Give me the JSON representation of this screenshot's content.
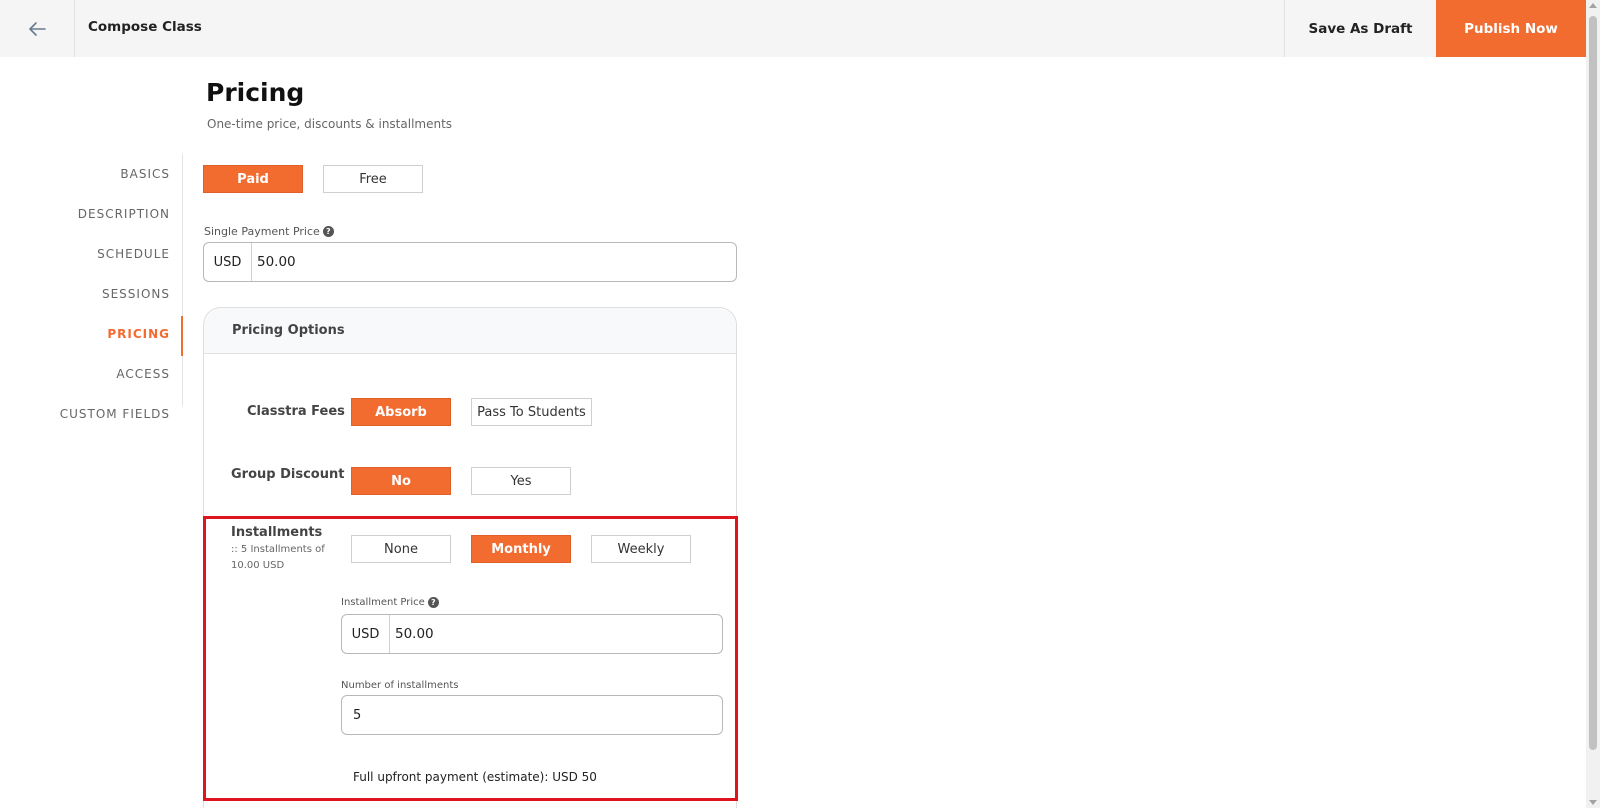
{
  "header": {
    "title": "Compose Class",
    "save_draft_label": "Save As Draft",
    "publish_label": "Publish Now"
  },
  "page": {
    "title": "Pricing",
    "subtitle": "One-time price, discounts & installments"
  },
  "sidebar": {
    "items": [
      {
        "label": "BASICS"
      },
      {
        "label": "DESCRIPTION"
      },
      {
        "label": "SCHEDULE"
      },
      {
        "label": "SESSIONS"
      },
      {
        "label": "PRICING",
        "active": true
      },
      {
        "label": "ACCESS"
      },
      {
        "label": "CUSTOM FIELDS"
      }
    ]
  },
  "pricing": {
    "type_options": {
      "paid": "Paid",
      "free": "Free",
      "selected": "Paid"
    },
    "single_price_label": "Single Payment Price",
    "currency": "USD",
    "single_price_value": "50.00"
  },
  "options": {
    "title": "Pricing Options",
    "fees": {
      "label": "Classtra Fees",
      "absorb": "Absorb",
      "pass": "Pass To Students",
      "selected": "Absorb"
    },
    "group_discount": {
      "label": "Group Discount",
      "no": "No",
      "yes": "Yes",
      "selected": "No"
    },
    "installments": {
      "label": "Installments",
      "note": ":: 5 Installments of 10.00 USD",
      "none": "None",
      "monthly": "Monthly",
      "weekly": "Weekly",
      "selected": "Monthly",
      "price_label": "Installment Price",
      "price_currency": "USD",
      "price_value": "50.00",
      "count_label": "Number of installments",
      "count_value": "5",
      "estimate": "Full upfront payment (estimate): USD 50"
    }
  },
  "colors": {
    "accent": "#f26b2f",
    "highlight": "#e0141e"
  },
  "icons": {
    "back": "arrow-left-icon",
    "help": "question-circle-icon"
  }
}
